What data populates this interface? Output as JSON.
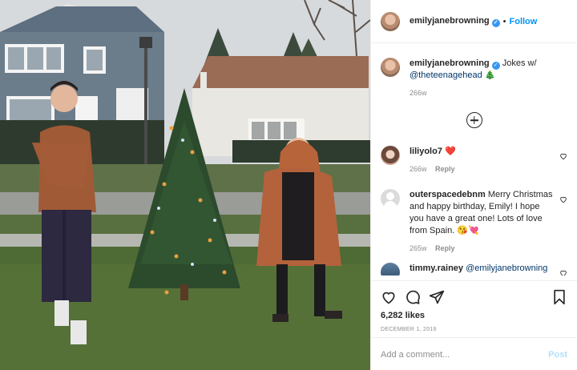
{
  "post": {
    "username": "emilyjanebrowning",
    "follow_label": "Follow",
    "dot": "•",
    "verified_mark": "✓"
  },
  "caption": {
    "username": "emilyjanebrowning",
    "text": "Jokes w/",
    "mention": "@theteenagehead",
    "emoji": "🎄",
    "age": "266w"
  },
  "comments": [
    {
      "username": "liliyolo7",
      "text": "❤️",
      "age": "266w",
      "reply_label": "Reply"
    },
    {
      "username": "outerspacedebnm",
      "text": "Merry Christmas and happy birthday, Emily! I hope you have a great one! Lots of love from Spain. 😘💘",
      "age": "265w",
      "reply_label": "Reply"
    },
    {
      "username": "timmy.rainey",
      "mention": "@emilyjanebrowning"
    }
  ],
  "likes": "6,282 likes",
  "date": "DECEMBER 1, 2016",
  "add_comment": {
    "placeholder": "Add a comment...",
    "post_label": "Post"
  },
  "colors": {
    "accent": "#0095f6",
    "verified": "#3897f0",
    "muted": "#8e8e8e",
    "post_disabled": "#b2dffc"
  },
  "icons": [
    "heart-icon",
    "comment-icon",
    "share-icon",
    "bookmark-icon",
    "plus-circle-icon",
    "verified-badge-icon"
  ]
}
